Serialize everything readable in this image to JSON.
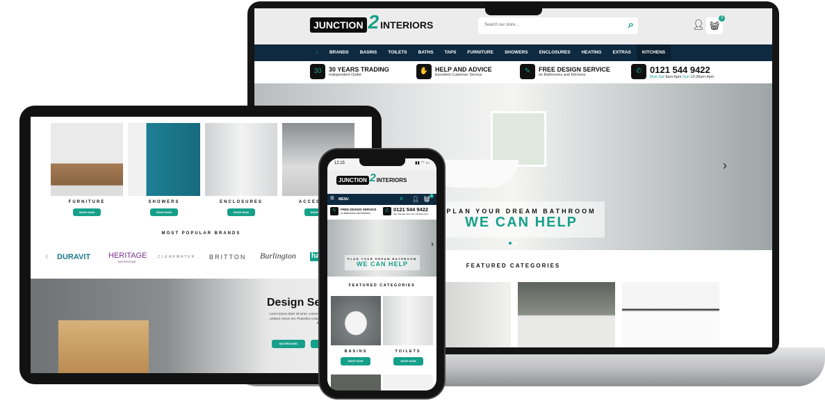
{
  "brand": {
    "logo_left": "JUNCTION",
    "logo_num": "2",
    "logo_right": "INTERIORS",
    "accent": "#16a08a",
    "navy": "#0e2a40"
  },
  "laptop": {
    "search_placeholder": "Search our store...",
    "cart_count": "3",
    "nav": [
      "BRANDS",
      "BASINS",
      "TOILETS",
      "BATHS",
      "TAPS",
      "FURNITURE",
      "SHOWERS",
      "ENCLOSURES",
      "HEATING",
      "EXTRAS",
      "KITCHENS"
    ],
    "usps": [
      {
        "icon": "30",
        "title": "30 YEARS TRADING",
        "sub": "Independent Outlet"
      },
      {
        "icon": "handshake-icon",
        "title": "HELP AND ADVICE",
        "sub": "Excellent Customer Service"
      },
      {
        "icon": "pencil-icon",
        "title": "FREE DESIGN SERVICE",
        "sub": "on Bathrooms and Kitchens"
      }
    ],
    "phone": {
      "number": "0121 544 9422",
      "days1": "Mon-Sat",
      "hours1": "9am-6pm",
      "days2": "Sun",
      "hours2": "10:30am-4pm"
    },
    "hero": {
      "kicker": "PLAN YOUR DREAM BATHROOM",
      "headline": "WE CAN HELP"
    },
    "featured_title": "FEATURED CATEGORIES"
  },
  "tablet": {
    "categories": [
      {
        "label": "FURNITURE",
        "button": "SHOP NOW"
      },
      {
        "label": "SHOWERS",
        "button": "SHOP NOW"
      },
      {
        "label": "ENCLOSURES",
        "button": "SHOP NOW"
      },
      {
        "label": "ACCESS",
        "button": "SHOP NOW"
      }
    ],
    "brands_title": "MOST POPULAR BRANDS",
    "brands": [
      "DURAVIT",
      "HERITAGE",
      "CLEARWATER",
      "BRITTON",
      "Burlington",
      "ha"
    ],
    "heritage_sub": "BATHROOMS",
    "design": {
      "title": "Design Ser",
      "body": "Lorem ipsum dolor sit amet, consectetur ante mauris. Vivamus quis neque pretium rutrum est. Phasellus volutpat, tellus vi tellus orci tincidunt felis, et dignissim la tristique velit at iaculis cons",
      "button1": "BATHROOMS"
    }
  },
  "phone": {
    "time": "12:15",
    "menu": "MENU",
    "cart_count": "3",
    "usp_title": "FREE DESIGN SERVICE",
    "usp_sub": "on Bathrooms and Kitchens",
    "phone_number": "0121 544 9422",
    "hours": "Mon-Sat 9am-6pm Sun 10:30am-4pm",
    "hero_kicker": "PLAN YOUR DREAM BATHROOM",
    "hero_headline": "WE CAN HELP",
    "featured_title": "FEATURED CATEGORIES",
    "categories": [
      {
        "label": "BASINS",
        "button": "SHOP NOW"
      },
      {
        "label": "TOILETS",
        "button": "SHOP NOW"
      }
    ]
  }
}
